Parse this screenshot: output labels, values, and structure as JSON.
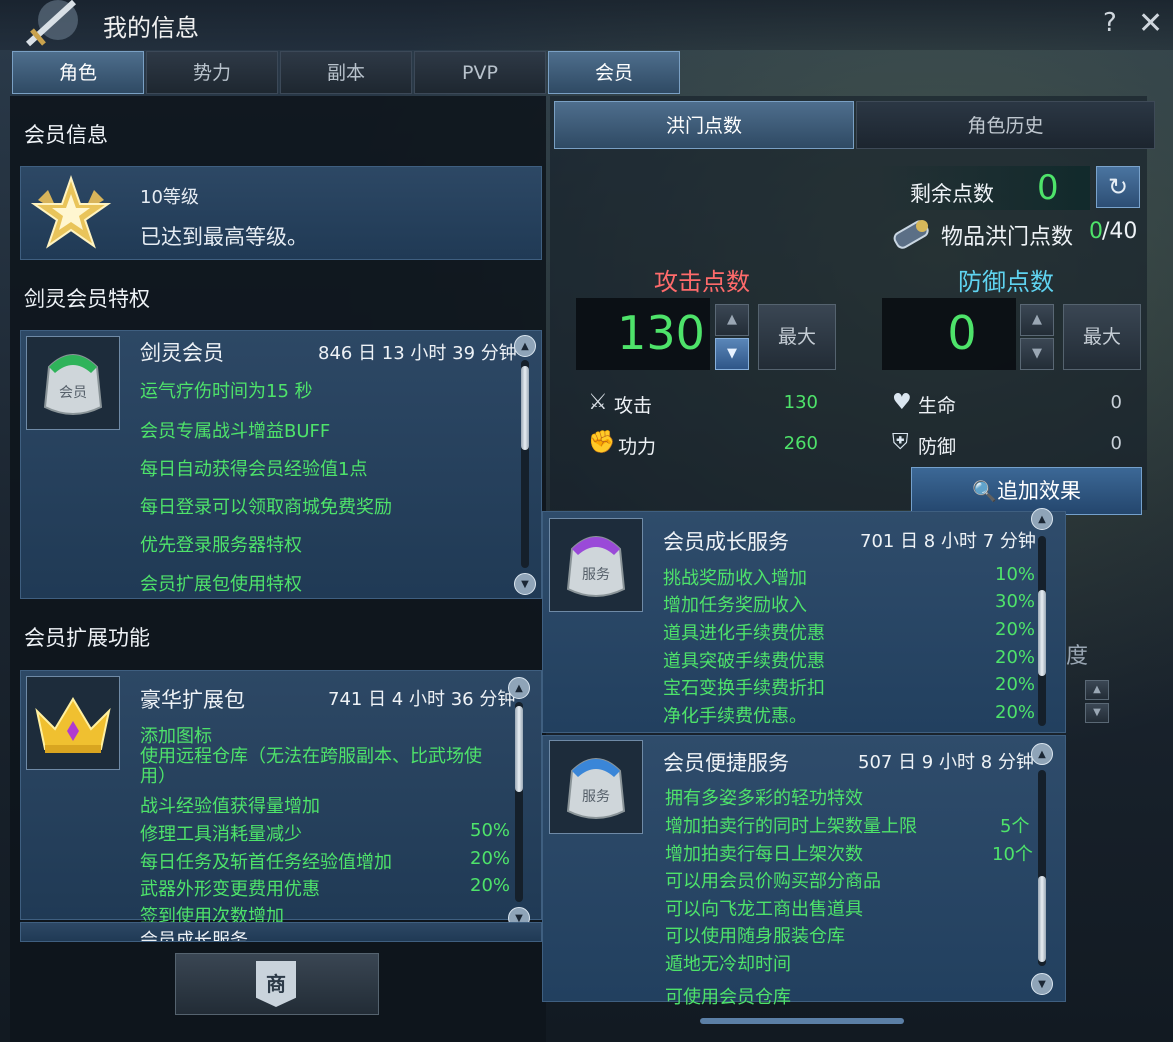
{
  "window": {
    "title": "我的信息",
    "help": "?",
    "close": "✕"
  },
  "tabs": [
    {
      "label": "角色",
      "active": true
    },
    {
      "label": "势力",
      "active": false
    },
    {
      "label": "副本",
      "active": false
    },
    {
      "label": "PVP",
      "active": false
    },
    {
      "label": "会员",
      "active": true
    }
  ],
  "left": {
    "member_info_title": "会员信息",
    "level": "10等级",
    "level_status": "已达到最高等级。",
    "privileges_title": "剑灵会员特权",
    "privilege_card": {
      "name": "剑灵会员",
      "time": "846 日 13 小时 39 分钟",
      "items": [
        "运气疗伤时间为15 秒",
        "会员专属战斗增益BUFF",
        "每日自动获得会员经验值1点",
        "每日登录可以领取商城免费奖励",
        "优先登录服务器特权",
        "会员扩展包使用特权"
      ]
    },
    "expansion_title": "会员扩展功能",
    "expansion_card": {
      "name": "豪华扩展包",
      "time": "741 日 4 小时 36 分钟",
      "items": [
        {
          "text": "添加图标",
          "value": ""
        },
        {
          "text": "使用远程仓库（无法在跨服副本、比武场使用）",
          "value": ""
        },
        {
          "text": "战斗经验值获得量增加",
          "value": ""
        },
        {
          "text": "修理工具消耗量减少",
          "value": "50%"
        },
        {
          "text": "每日任务及斩首任务经验值增加",
          "value": "20%"
        },
        {
          "text": "武器外形变更费用优惠",
          "value": "20%"
        },
        {
          "text": "签到使用次数增加",
          "value": ""
        }
      ],
      "next_partial": "会员成长服务"
    },
    "bottom_button_glyph": "商"
  },
  "right": {
    "subtabs": [
      {
        "label": "洪门点数",
        "active": true
      },
      {
        "label": "角色历史",
        "active": false
      }
    ],
    "remaining_label": "剩余点数",
    "remaining_value": "0",
    "item_points_label": "物品洪门点数",
    "item_points_current": "0",
    "item_points_max": "/40",
    "attack_title": "攻击点数",
    "defense_title": "防御点数",
    "attack_value": "130",
    "defense_value": "0",
    "max_label": "最大",
    "stats": [
      {
        "icon": "swords-icon",
        "label": "攻击",
        "value": "130"
      },
      {
        "icon": "fist-icon",
        "label": "功力",
        "value": "260"
      },
      {
        "icon": "heart-icon",
        "label": "生命",
        "value": "0"
      },
      {
        "icon": "shield-icon",
        "label": "防御",
        "value": "0"
      }
    ],
    "add_effect_label": "追加效果",
    "bg_partial": "度"
  },
  "popup": {
    "growth": {
      "name": "会员成长服务",
      "time": "701 日 8 小时 7 分钟",
      "items": [
        {
          "text": "挑战奖励收入增加",
          "value": "10%"
        },
        {
          "text": "增加任务奖励收入",
          "value": "30%"
        },
        {
          "text": "道具进化手续费优惠",
          "value": "20%"
        },
        {
          "text": "道具突破手续费优惠",
          "value": "20%"
        },
        {
          "text": "宝石变换手续费折扣",
          "value": "20%"
        },
        {
          "text": "净化手续费优惠。",
          "value": "20%"
        }
      ]
    },
    "convenience": {
      "name": "会员便捷服务",
      "time": "507 日 9 小时 8 分钟",
      "items": [
        {
          "text": "拥有多姿多彩的轻功特效",
          "value": ""
        },
        {
          "text": "增加拍卖行的同时上架数量上限",
          "value": "5个"
        },
        {
          "text": "增加拍卖行每日上架次数",
          "value": "10个"
        },
        {
          "text": "可以用会员价购买部分商品",
          "value": ""
        },
        {
          "text": "可以向飞龙工商出售道具",
          "value": ""
        },
        {
          "text": "可以使用随身服装仓库",
          "value": ""
        },
        {
          "text": "遁地无冷却时间",
          "value": ""
        },
        {
          "text": "可使用会员仓库",
          "value": ""
        }
      ]
    }
  },
  "colors": {
    "green": "#4ee36a",
    "attack_title": "#ff6b6b",
    "defense_title": "#5fd3f0",
    "accent": "#3f6d99"
  }
}
